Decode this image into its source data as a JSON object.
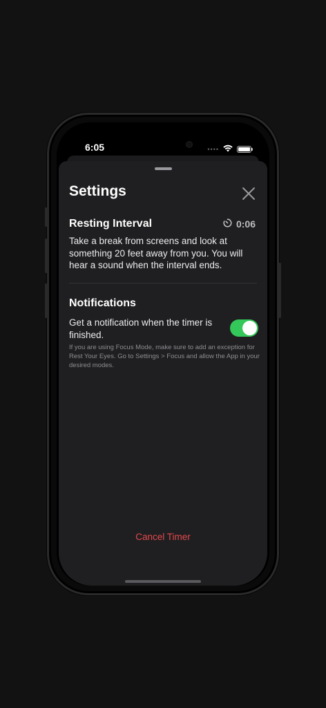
{
  "status_bar": {
    "time": "6:05",
    "signal": "••••"
  },
  "sheet": {
    "title": "Settings",
    "close_icon": "close-icon"
  },
  "resting_interval": {
    "title": "Resting Interval",
    "timer_value": "0:06",
    "timer_icon": "timer-icon",
    "description": "Take a break from screens and look at something 20 feet away from you. You will hear a sound when the interval ends."
  },
  "notifications": {
    "title": "Notifications",
    "toggle_label": "Get a notification when the timer is finished.",
    "toggle_on": true,
    "footnote": "If you are using Focus Mode, make sure to add an exception for Rest Your Eyes. Go to Settings > Focus and allow the App in your desired modes."
  },
  "cancel_label": "Cancel Timer",
  "colors": {
    "accent_green": "#34c759",
    "destructive_red": "#e5484d",
    "sheet_bg": "#1f1f21"
  }
}
